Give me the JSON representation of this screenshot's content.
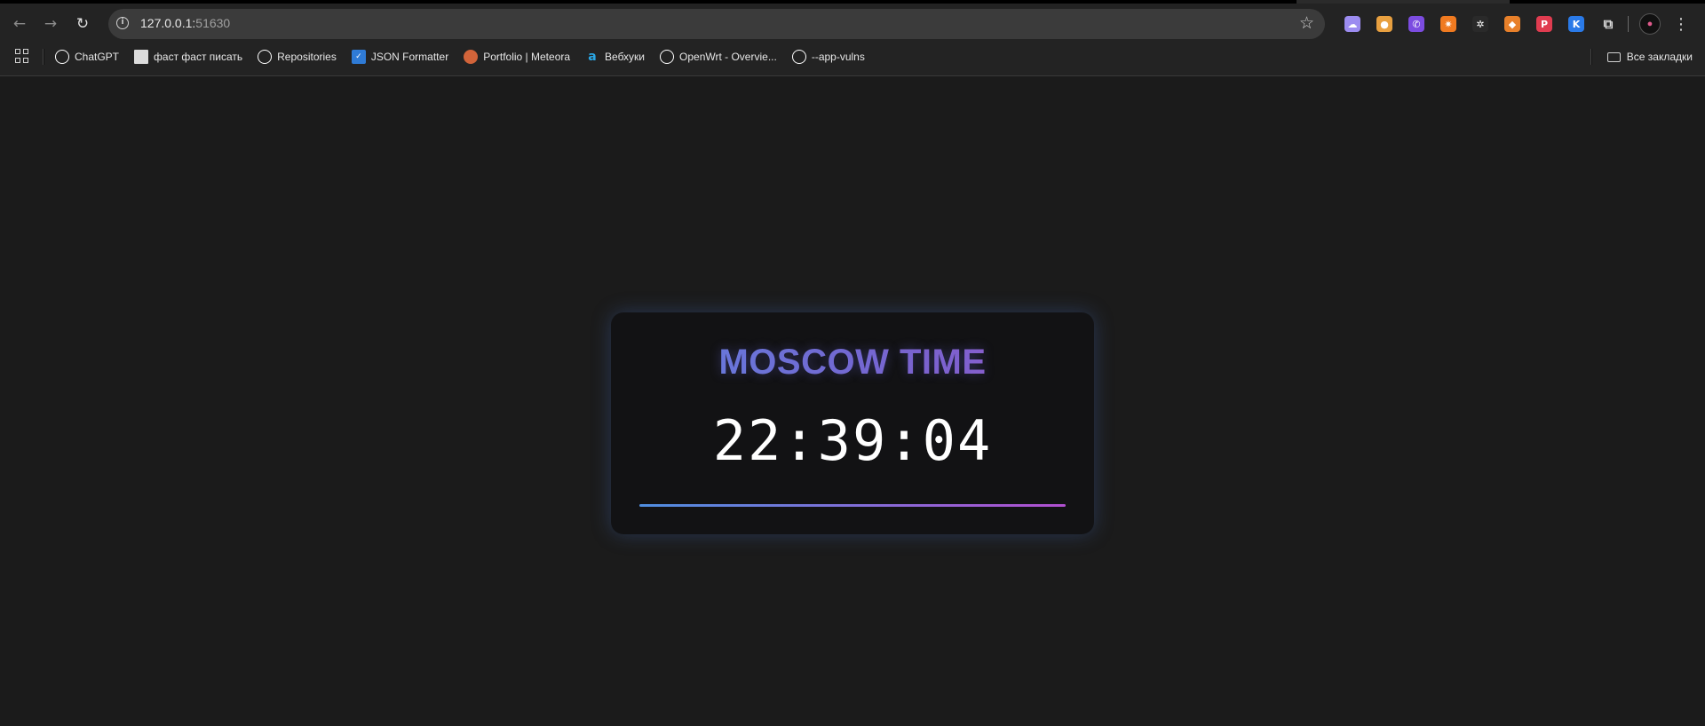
{
  "browser": {
    "url_host": "127.0.0.1:",
    "url_port": "51630",
    "bookmarks": [
      {
        "label": "ChatGPT",
        "icon": "chatgpt-icon",
        "color": "#ffffff"
      },
      {
        "label": "фаст фаст писать",
        "icon": "page-icon",
        "color": "#dcdcdc"
      },
      {
        "label": "Repositories",
        "icon": "github-icon",
        "color": "#ffffff"
      },
      {
        "label": "JSON Formatter",
        "icon": "checkbox-icon",
        "color": "#2f7bd6"
      },
      {
        "label": "Portfolio | Meteora",
        "icon": "meteora-icon",
        "color": "#d2643a"
      },
      {
        "label": "Вебхуки",
        "icon": "webhook-icon",
        "color": "#2aa7e6"
      },
      {
        "label": "OpenWrt - Overvie...",
        "icon": "openwrt-icon",
        "color": "#ffffff"
      },
      {
        "label": "--app-vulns",
        "icon": "github-icon",
        "color": "#ffffff"
      }
    ],
    "all_bookmarks_label": "Все закладки",
    "extensions": [
      {
        "name": "ghost-extension-icon",
        "color": "#9c8cf0",
        "glyph": "☁"
      },
      {
        "name": "cookie-extension-icon",
        "color": "#e8a040",
        "glyph": "●"
      },
      {
        "name": "viber-extension-icon",
        "color": "#7c4ce0",
        "glyph": "✆"
      },
      {
        "name": "spark-extension-icon",
        "color": "#f07a20",
        "glyph": "✷"
      },
      {
        "name": "dark-extension-icon",
        "color": "#2a2a2a",
        "glyph": "✲"
      },
      {
        "name": "metamask-extension-icon",
        "color": "#e8802a",
        "glyph": "◆"
      },
      {
        "name": "pocket-extension-icon",
        "color": "#e03c50",
        "glyph": "P"
      },
      {
        "name": "k-extension-icon",
        "color": "#2a7ae8",
        "glyph": "K"
      }
    ]
  },
  "clock": {
    "title": "MOSCOW TIME",
    "time": "22:39:04"
  }
}
